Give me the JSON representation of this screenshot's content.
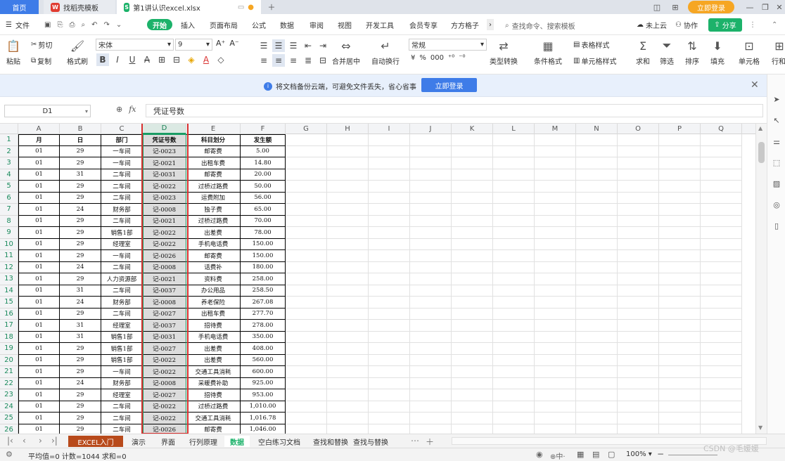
{
  "titlebar": {
    "tabs": [
      {
        "label": "首页"
      },
      {
        "label": "找稻壳模板"
      },
      {
        "label": "第1讲认识excel.xlsx"
      }
    ],
    "login": "立即登录"
  },
  "menubar": {
    "file": "文件",
    "items": [
      "开始",
      "插入",
      "页面布局",
      "公式",
      "数据",
      "审阅",
      "视图",
      "开发工具",
      "会员专享",
      "方方格子"
    ],
    "search": "查找命令、搜索模板",
    "cloud": "未上云",
    "collab": "协作",
    "share": "分享"
  },
  "ribbon": {
    "paste": "粘贴",
    "cut": "剪切",
    "copy": "复制",
    "format_painter": "格式刷",
    "font_name": "宋体",
    "font_size": "9",
    "merge": "合并居中",
    "wrap": "自动换行",
    "number_format": "常规",
    "type_convert": "类型转换",
    "cond_format": "条件格式",
    "table_style": "表格样式",
    "cell_style": "单元格样式",
    "sum": "求和",
    "filter": "筛选",
    "sort": "排序",
    "fill": "填充",
    "cell": "单元格",
    "rowcol": "行和"
  },
  "notice": {
    "text": "将文档备份云端，可避免文件丢失，省心省事",
    "button": "立即登录"
  },
  "formula_bar": {
    "name_box": "D1",
    "fx": "fx",
    "content": "凭证号数"
  },
  "columns": [
    "A",
    "B",
    "C",
    "D",
    "E",
    "F",
    "G",
    "H",
    "I",
    "J",
    "K",
    "L",
    "M",
    "N",
    "O",
    "P",
    "Q"
  ],
  "selected_column": "D",
  "table": {
    "headers": [
      "月",
      "日",
      "部门",
      "凭证号数",
      "科目划分",
      "发生额"
    ],
    "rows": [
      [
        "01",
        "29",
        "一车间",
        "记-0023",
        "邮寄费",
        "5.00"
      ],
      [
        "01",
        "29",
        "一车间",
        "记-0021",
        "出租车费",
        "14.80"
      ],
      [
        "01",
        "31",
        "二车间",
        "记-0031",
        "邮寄费",
        "20.00"
      ],
      [
        "01",
        "29",
        "二车间",
        "记-0022",
        "过桥过路费",
        "50.00"
      ],
      [
        "01",
        "29",
        "二车间",
        "记-0023",
        "运费附加",
        "56.00"
      ],
      [
        "01",
        "24",
        "财务部",
        "记-0008",
        "独子费",
        "65.00"
      ],
      [
        "01",
        "29",
        "二车间",
        "记-0021",
        "过桥过路费",
        "70.00"
      ],
      [
        "01",
        "29",
        "销售1部",
        "记-0022",
        "出差费",
        "78.00"
      ],
      [
        "01",
        "29",
        "经理室",
        "记-0022",
        "手机电话费",
        "150.00"
      ],
      [
        "01",
        "29",
        "一车间",
        "记-0026",
        "邮寄费",
        "150.00"
      ],
      [
        "01",
        "24",
        "二车间",
        "记-0008",
        "话费补",
        "180.00"
      ],
      [
        "01",
        "29",
        "人力资源部",
        "记-0021",
        "资料费",
        "258.00"
      ],
      [
        "01",
        "31",
        "二车间",
        "记-0037",
        "办公用品",
        "258.50"
      ],
      [
        "01",
        "24",
        "财务部",
        "记-0008",
        "养老保险",
        "267.08"
      ],
      [
        "01",
        "29",
        "二车间",
        "记-0027",
        "出租车费",
        "277.70"
      ],
      [
        "01",
        "31",
        "经理室",
        "记-0037",
        "招待费",
        "278.00"
      ],
      [
        "01",
        "31",
        "销售1部",
        "记-0031",
        "手机电话费",
        "350.00"
      ],
      [
        "01",
        "29",
        "销售1部",
        "记-0027",
        "出差费",
        "408.00"
      ],
      [
        "01",
        "29",
        "销售1部",
        "记-0022",
        "出差费",
        "560.00"
      ],
      [
        "01",
        "29",
        "一车间",
        "记-0022",
        "交通工具消耗",
        "600.00"
      ],
      [
        "01",
        "24",
        "财务部",
        "记-0008",
        "采暖费补助",
        "925.00"
      ],
      [
        "01",
        "29",
        "经理室",
        "记-0027",
        "招待费",
        "953.00"
      ],
      [
        "01",
        "29",
        "二车间",
        "记-0022",
        "过桥过路费",
        "1,010.00"
      ],
      [
        "01",
        "29",
        "二车间",
        "记-0022",
        "交通工具消耗",
        "1,016.78"
      ],
      [
        "01",
        "29",
        "二车间",
        "记-0026",
        "邮寄费",
        "1,046.00"
      ]
    ]
  },
  "sheets": [
    "EXCEL入门",
    "演示",
    "界面",
    "行列原理",
    "数据",
    "空白练习文档",
    "查找和替换",
    "查找与替换"
  ],
  "active_sheet": "数据",
  "status": {
    "summary": "平均值=0  计数=1044  求和=0",
    "zoom": "100%"
  },
  "watermark": "CSDN @毛媛媛",
  "colors": {
    "accent_green": "#1cb26a",
    "selection_red": "#d9302f",
    "brand_blue": "#3e7ce8"
  }
}
